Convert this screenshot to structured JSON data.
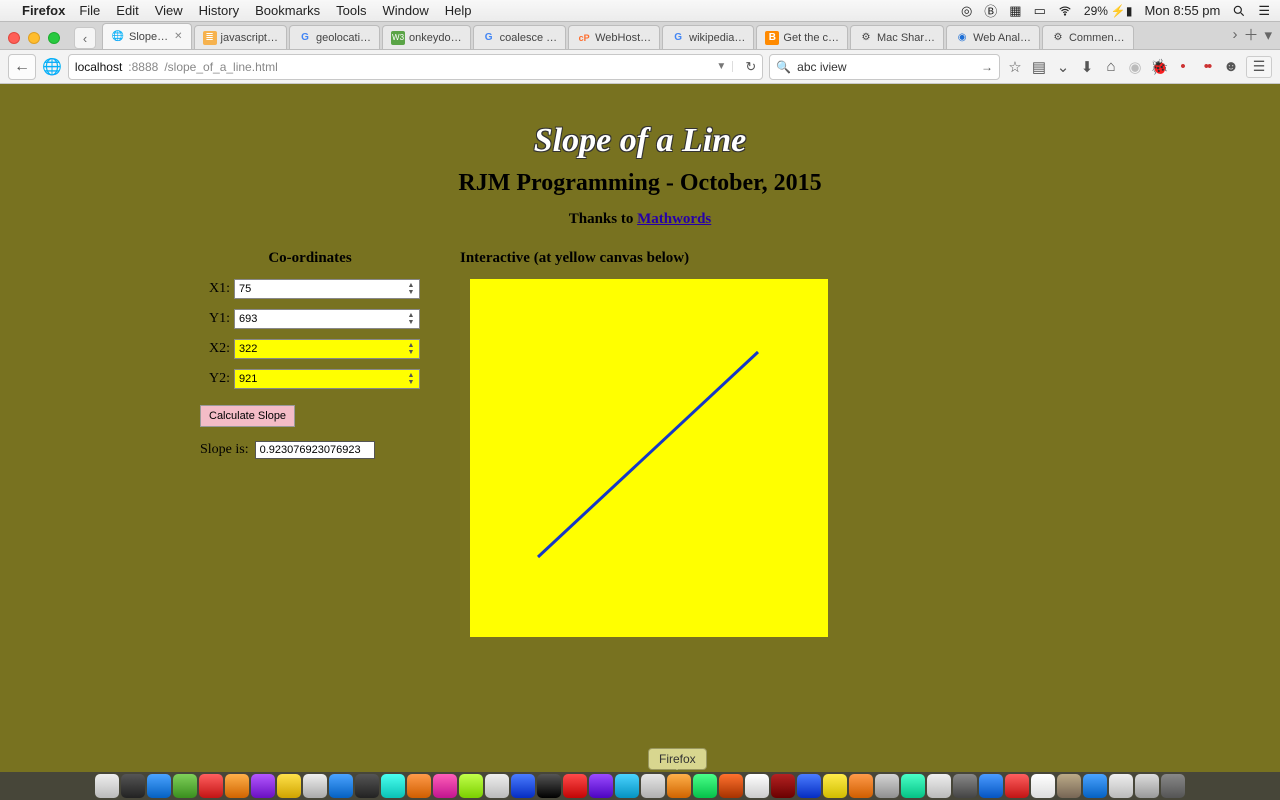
{
  "menubar": {
    "app": "Firefox",
    "items": [
      "File",
      "Edit",
      "View",
      "History",
      "Bookmarks",
      "Tools",
      "Window",
      "Help"
    ],
    "battery": "29%",
    "clock": "Mon 8:55 pm"
  },
  "tabs": [
    {
      "label": "Slope…",
      "active": true,
      "icon": "globe",
      "closeable": true
    },
    {
      "label": "javascript…",
      "icon": "stack"
    },
    {
      "label": "geolocati…",
      "icon": "g"
    },
    {
      "label": "onkeydo…",
      "icon": "w3"
    },
    {
      "label": "coalesce …",
      "icon": "g"
    },
    {
      "label": "WebHost…",
      "icon": "cp"
    },
    {
      "label": "wikipedia…",
      "icon": "g"
    },
    {
      "label": "Get the c…",
      "icon": "b"
    },
    {
      "label": "Mac Shar…",
      "icon": "gear"
    },
    {
      "label": "Web Anal…",
      "icon": "globe2"
    },
    {
      "label": "Commen…",
      "icon": "gear"
    }
  ],
  "url": {
    "host": "localhost",
    "port": ":8888",
    "path": "/slope_of_a_line.html"
  },
  "search": {
    "value": "abc iview"
  },
  "page": {
    "title": "Slope of a Line",
    "subtitle": "RJM Programming - October, 2015",
    "thanks_prefix": "Thanks to ",
    "thanks_link": "Mathwords",
    "coords_header": "Co-ordinates",
    "interactive_header": "Interactive (at yellow canvas below)",
    "labels": {
      "x1": "X1:",
      "y1": "Y1:",
      "x2": "X2:",
      "y2": "Y2:"
    },
    "values": {
      "x1": "75",
      "y1": "693",
      "x2": "322",
      "y2": "921"
    },
    "calc_label": "Calculate Slope",
    "slope_label": "Slope is:",
    "slope_value": "0.923076923076923"
  },
  "dock_tooltip": "Firefox"
}
